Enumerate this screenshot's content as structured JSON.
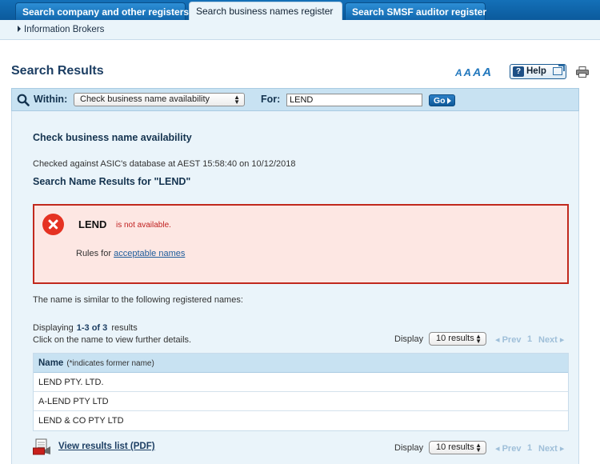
{
  "tabs": [
    {
      "label": "Search company and other registers",
      "active": false
    },
    {
      "label": "Search business names register",
      "active": true
    },
    {
      "label": "Search SMSF auditor register",
      "active": false
    }
  ],
  "subnav": {
    "item": "Information Brokers"
  },
  "page": {
    "title": "Search Results",
    "help_label": "Help",
    "font_sizes": [
      "A",
      "A",
      "A",
      "A"
    ]
  },
  "search": {
    "within_label": "Within:",
    "within_value": "Check business name availability",
    "for_label": "For:",
    "query": "LEND",
    "go_label": "Go"
  },
  "result": {
    "heading": "Check business name availability",
    "checked_text": "Checked against ASIC's database at AEST 15:58:40 on 10/12/2018",
    "results_title": "Search Name Results for \"LEND\"",
    "name": "LEND",
    "status": "is not available.",
    "rules_prefix": "Rules for",
    "rules_link": "acceptable names",
    "similar_text": "The name is similar to the following registered names:"
  },
  "listing": {
    "displaying_label": "Displaying",
    "range": "1-3 of 3",
    "results_word": "results",
    "click_note": "Click on the name to view further details.",
    "display_label": "Display",
    "display_option": "10 results",
    "prev_label": "Prev",
    "page_number": "1",
    "next_label": "Next"
  },
  "table": {
    "header_name": "Name",
    "header_note": "(*indicates former name)",
    "rows": [
      "LEND PTY. LTD.",
      "A-LEND PTY LTD",
      "LEND & CO PTY LTD"
    ]
  },
  "pdf": {
    "label": "View results list (PDF)"
  },
  "colors": {
    "tab_bar": "#0b5a9c",
    "panel": "#eaf4fa",
    "error_border": "#c1291d",
    "error_bg": "#fde7e3",
    "error_icon": "#e53222"
  }
}
